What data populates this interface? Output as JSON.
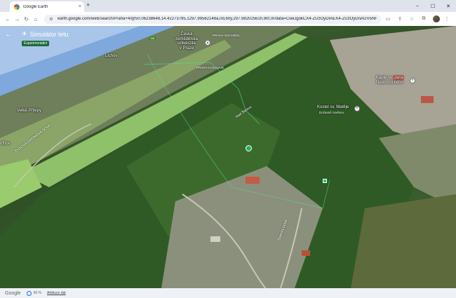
{
  "browser": {
    "tab_title": "Google Earth",
    "tab_close": "×",
    "new_tab": "+",
    "url": "earth.google.com/web/search/Praha+4/@50.06238648,14.42273795,1297.99562148a,0d,60y,297.98202561h,90t,0r/data=CiwiJgokCX4-ZUzOyDIAEX4-ZUzOyDnAGV5NH1h7K...",
    "window_buttons": [
      "–",
      "☐",
      "✕"
    ]
  },
  "app": {
    "title": "Simulátor letu",
    "badge": "Experimentální"
  },
  "map_labels": {
    "university": "Česká\nzemědělská\nuniverzita\nv Praze",
    "praha_suchdol": "PRAHA-SUCHDOL",
    "praha_lysolaje": "PRAHA-LYSOLAJE",
    "chapel": "Kaple sv. Jana\nNepomuckého",
    "church": "Kostel sv. Matěje",
    "church_sub": "Dočasně zavřeno",
    "velke_prilepy": "Velké Přílepy",
    "office": "office",
    "road_1": "ŠTÍTOVÁ-GRONOVA-SOVA",
    "road_2": "Nad Šárkou",
    "road_3": "Šárecký potok",
    "area_top": "Lichov",
    "badge_top": "D8"
  },
  "status": {
    "logo": "Google",
    "percent": "99 %",
    "attribution": "Atribuce dat"
  }
}
